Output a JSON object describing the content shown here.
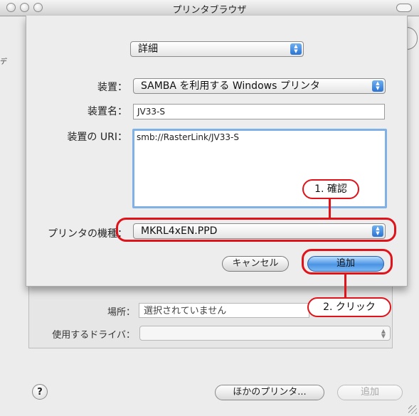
{
  "window": {
    "title": "プリンタブラウザ"
  },
  "background": {
    "partial_tab_char": "デ",
    "location_label": "場所：",
    "location_value": "選択されていません",
    "driver_label": "使用するドライバ：",
    "driver_value": "",
    "help_glyph": "?",
    "other_printers_button": "ほかのプリンタ...",
    "add_button": "追加"
  },
  "sheet": {
    "mode_select": "詳細",
    "device_label": "装置：",
    "device_value": "SAMBA を利用する Windows プリンタ",
    "device_name_label": "装置名：",
    "device_name_value": "JV33-S",
    "device_uri_label": "装置の URI：",
    "device_uri_value": "smb://RasterLink/JV33-S",
    "printer_model_label": "プリンタの機種：",
    "printer_model_value": "MKRL4xEN.PPD",
    "cancel_button": "キャンセル",
    "add_button": "追加"
  },
  "annotations": {
    "step1": "1. 確認",
    "step2": "2. クリック"
  },
  "colors": {
    "annotation_red": "#e0121a",
    "default_button_blue": "#4a93e3",
    "focus_ring": "#7fb1e6"
  }
}
